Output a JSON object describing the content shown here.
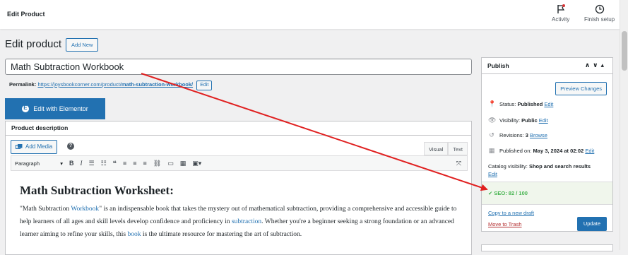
{
  "topbar": {
    "title": "Edit Product",
    "activity_label": "Activity",
    "finish_setup_label": "Finish setup"
  },
  "page": {
    "heading": "Edit product",
    "add_new_label": "Add New",
    "product_title": "Math Subtraction Workbook",
    "permalink_label": "Permalink:",
    "permalink_base": "https://joysbookcorner.com/product/",
    "permalink_slug": "math-subtraction-workbook/",
    "permalink_edit_label": "Edit",
    "elementor_label": "Edit with Elementor"
  },
  "editor": {
    "section_title": "Product description",
    "add_media_label": "Add Media",
    "tab_visual": "Visual",
    "tab_text": "Text",
    "format_select": "Paragraph",
    "heading": "Math Subtraction Worksheet:",
    "para1_start": "\"Math Subtraction ",
    "para1_link1": "Workbook",
    "para1_mid": "\" is an indispensable book that takes the mystery out of mathematical subtraction, providing a comprehensive and accessible guide to help learners of all ages and skill levels develop confidence and proficiency in ",
    "para1_link2": "subtraction",
    "para1_mid2": ". Whether you're a beginner seeking a strong foundation or an advanced learner aiming to refine your skills, this ",
    "para1_link3": "book",
    "para1_end": " is the ultimate resource for mastering the art of subtraction."
  },
  "publish": {
    "title": "Publish",
    "preview_label": "Preview Changes",
    "status_label": "Status:",
    "status_value": "Published",
    "status_edit": "Edit",
    "visibility_label": "Visibility:",
    "visibility_value": "Public",
    "visibility_edit": "Edit",
    "revisions_label": "Revisions:",
    "revisions_value": "3",
    "revisions_browse": "Browse",
    "published_on_label": "Published on:",
    "published_on_value": "May 3, 2024 at 02:02",
    "published_on_edit": "Edit",
    "catalog_label": "Catalog visibility:",
    "catalog_value": "Shop and search results",
    "catalog_edit": "Edit",
    "seo_text": "SEO: 82 / 100",
    "copy_draft": "Copy to a new draft",
    "move_trash": "Move to Trash",
    "update_label": "Update"
  },
  "colors": {
    "accent": "#2271b1",
    "annotation_arrow": "#e02020",
    "seo_green": "#46b450",
    "trash_red": "#b32d2e"
  }
}
